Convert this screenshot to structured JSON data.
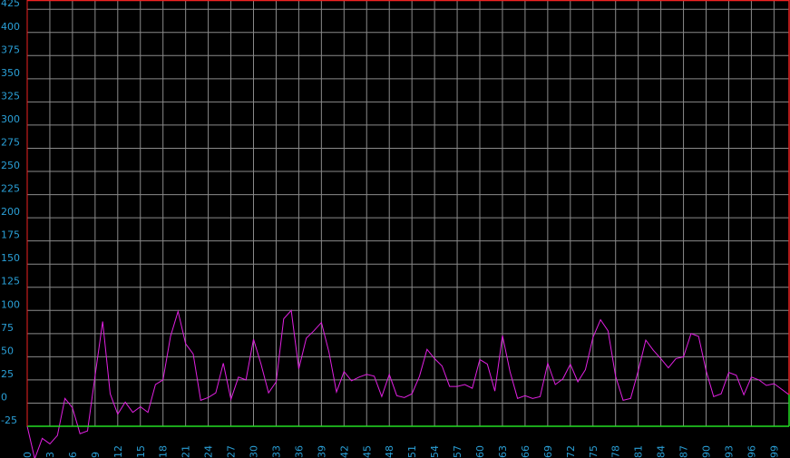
{
  "chart_data": {
    "type": "line",
    "title": "",
    "xlabel": "",
    "ylabel": "",
    "xlim": [
      0,
      101
    ],
    "ylim": [
      -25,
      435
    ],
    "grid": true,
    "yticks": [
      -25,
      0,
      25,
      50,
      75,
      100,
      125,
      150,
      175,
      200,
      225,
      250,
      275,
      300,
      325,
      350,
      375,
      400,
      425
    ],
    "ytick_labels": [
      "-25",
      "0",
      "25",
      "50",
      "75",
      "100",
      "125",
      "150",
      "175",
      "200",
      "225",
      "250",
      "275",
      "300",
      "325",
      "350",
      "375",
      "400",
      "425"
    ],
    "xticks": [
      0,
      3,
      6,
      9,
      12,
      15,
      18,
      21,
      24,
      27,
      30,
      33,
      36,
      39,
      42,
      45,
      48,
      51,
      54,
      57,
      60,
      63,
      66,
      69,
      72,
      75,
      78,
      81,
      84,
      87,
      90,
      93,
      96,
      99
    ],
    "xtick_labels": [
      "0",
      "3",
      "6",
      "9",
      "12",
      "15",
      "18",
      "21",
      "24",
      "27",
      "30",
      "33",
      "36",
      "39",
      "42",
      "45",
      "48",
      "51",
      "54",
      "57",
      "60",
      "63",
      "66",
      "69",
      "72",
      "75",
      "78",
      "81",
      "84",
      "87",
      "90",
      "93",
      "96",
      "99"
    ],
    "baseline_y": -25,
    "series": [
      {
        "color": "#e020e0",
        "x": [
          0,
          1,
          2,
          3,
          4,
          5,
          6,
          7,
          8,
          9,
          10,
          11,
          12,
          13,
          14,
          15,
          16,
          17,
          18,
          19,
          20,
          21,
          22,
          23,
          24,
          25,
          26,
          27,
          28,
          29,
          30,
          31,
          32,
          33,
          34,
          35,
          36,
          37,
          38,
          39,
          40,
          41,
          42,
          43,
          44,
          45,
          46,
          47,
          48,
          49,
          50,
          51,
          52,
          53,
          54,
          55,
          56,
          57,
          58,
          59,
          60,
          61,
          62,
          63,
          64,
          65,
          66,
          67,
          68,
          69,
          70,
          71,
          72,
          73,
          74,
          75,
          76,
          77,
          78,
          79,
          80,
          81,
          82,
          83,
          84,
          85,
          86,
          87,
          88,
          89,
          90,
          91,
          92,
          93,
          94,
          95,
          96,
          97,
          98,
          99,
          100,
          101
        ],
        "values": [
          -25,
          -60,
          -38,
          -44,
          -35,
          5,
          -5,
          -33,
          -30,
          30,
          88,
          10,
          -12,
          1,
          -10,
          -4,
          -10,
          20,
          25,
          72,
          99,
          64,
          53,
          3,
          6,
          11,
          43,
          4,
          28,
          25,
          69,
          42,
          11,
          23,
          91,
          100,
          37,
          70,
          78,
          87,
          55,
          12,
          34,
          24,
          28,
          31,
          29,
          7,
          31,
          8,
          6,
          10,
          29,
          58,
          48,
          40,
          18,
          18,
          20,
          16,
          47,
          42,
          13,
          73,
          34,
          5,
          8,
          5,
          7,
          43,
          20,
          26,
          42,
          23,
          36,
          71,
          90,
          78,
          29,
          3,
          5,
          35,
          68,
          57,
          48,
          38,
          48,
          50,
          75,
          72,
          35,
          7,
          10,
          33,
          30,
          9,
          28,
          25,
          19,
          21,
          15,
          9
        ]
      }
    ]
  }
}
